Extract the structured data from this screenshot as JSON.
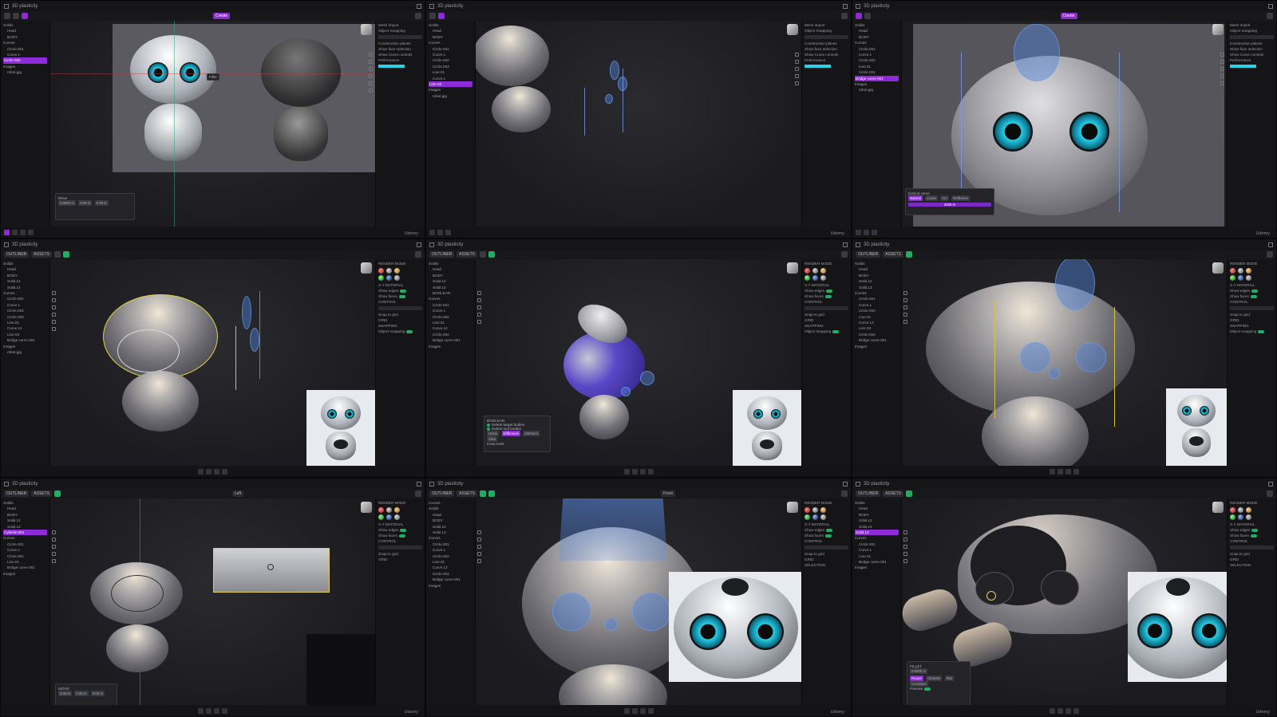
{
  "app": {
    "doc_title": "3D plasticity",
    "watermark": "Udemy",
    "colors": {
      "accent": "#8e2bd9",
      "toggle": "#1fae63",
      "selection_cyan": "#24d4e6",
      "viewport_bg": "#1e1e22"
    }
  },
  "cells": [
    {
      "id": "c1",
      "mode_label": "Create",
      "outliner": [
        "Solids",
        "Head",
        "BODY",
        "Curves",
        "Circle.001",
        "Curve.1",
        "Circle.002",
        "Images",
        "robot.jpg"
      ],
      "outliner_selected": "Circle.002",
      "props": [
        "Mesh Import",
        "Fillet",
        "Object Snapping",
        "Construction planes",
        "Show face selection",
        "Show Curve controls",
        "Performance"
      ],
      "popup": {
        "title": "Move",
        "fields": [
          "0.0000 m",
          "0.00 m",
          "0.00 m"
        ]
      },
      "tooltip": "Fillet"
    },
    {
      "id": "c2",
      "mode_label": "",
      "outliner": [
        "Solids",
        "Head",
        "BODY",
        "Curves",
        "Circle.001",
        "Curve.1",
        "Circle.002",
        "Circle.003",
        "Line.01",
        "Curve.1",
        "Line.03",
        "Images",
        "robot.jpg"
      ],
      "outliner_selected": "Line.03",
      "props": [
        "Mesh Import",
        "Object Snapping",
        "Construction planes",
        "Show face selection",
        "Show Curve controls",
        "Performance"
      ]
    },
    {
      "id": "c3",
      "mode_label": "Create",
      "outliner": [
        "Solids",
        "Head",
        "BODY",
        "Curves",
        "Circle.001",
        "Curve.1",
        "Circle.002",
        "Line.01",
        "Circle.004",
        "Bridge curve.001",
        "Images",
        "robot.jpg"
      ],
      "outliner_selected": "Bridge curve.001",
      "props": [
        "Mesh Import",
        "Object Snapping",
        "Construction planes",
        "Show face selection",
        "Show Curve controls",
        "Performance"
      ],
      "popup": {
        "title": "Extend curve",
        "chips": [
          "Natural",
          "Linear",
          "Arc",
          "Reflective",
          "Arc"
        ],
        "field": "2000 m"
      }
    },
    {
      "id": "c4",
      "tabs": [
        "OUTLINER",
        "ASSETS"
      ],
      "outliner": [
        "Solids",
        "Head",
        "BODY",
        "Solid.12",
        "Solid.13",
        "Curves",
        "Circle.001",
        "Curve.1",
        "Circle.002",
        "Circle.003",
        "Line.01",
        "Curve.12",
        "Line.03",
        "Bridge curve.001",
        "Images",
        "robot.jpg"
      ],
      "props": [
        "RENDER MODE",
        "X-Y MATERIAL",
        "Show edges",
        "Show faces",
        "CONTROL",
        "Snap to grid",
        "GRID",
        "SNAPPING",
        "Object snapping"
      ]
    },
    {
      "id": "c5",
      "tabs": [
        "OUTLINER",
        "ASSETS"
      ],
      "outliner": [
        "Solids",
        "Head",
        "BODY",
        "Solid.12",
        "Solid.13",
        "BOOLEAN",
        "Curves",
        "Circle.001",
        "Curve.1",
        "Circle.002",
        "Line.01",
        "Curve.12",
        "Circle.004",
        "Bridge curve.001",
        "Images"
      ],
      "props": [
        "RENDER MODE",
        "X-Y MATERIAL",
        "Show edges",
        "Show faces",
        "CONTROL",
        "Snap to grid",
        "GRID",
        "SNAPPING",
        "Object snapping"
      ],
      "popup": {
        "title": "BOOLEAN",
        "options": [
          "Delete target bodies",
          "Delete tool bodies"
        ],
        "chips": [
          "Union",
          "Difference",
          "Intersect",
          "Slice"
        ],
        "footer": "Keep tools"
      }
    },
    {
      "id": "c6",
      "tabs": [
        "OUTLINER",
        "ASSETS"
      ],
      "outliner": [
        "Solids",
        "Head",
        "BODY",
        "Solid.12",
        "Solid.13",
        "Curves",
        "Circle.001",
        "Curve.1",
        "Circle.002",
        "Line.01",
        "Curve.12",
        "Line.03",
        "Circle.004",
        "Bridge curve.001",
        "Images"
      ],
      "props": [
        "RENDER MODE",
        "X-Y MATERIAL",
        "Show edges",
        "Show faces",
        "CONTROL",
        "Snap to grid",
        "GRID",
        "SNAPPING",
        "Object snapping"
      ]
    },
    {
      "id": "c7",
      "tabs": [
        "OUTLINER",
        "ASSETS"
      ],
      "outliner": [
        "Solids",
        "Head",
        "BODY",
        "Solid.12",
        "Solid.13",
        "Cylinder.001",
        "Curves",
        "Circle.001",
        "Curve.1",
        "Circle.002",
        "Line.01",
        "Bridge curve.001",
        "Images"
      ],
      "outliner_selected": "Cylinder.001",
      "props": [
        "RENDER MODE",
        "X-Y MATERIAL",
        "Show edges",
        "Show faces",
        "CONTROL",
        "Snap to grid",
        "GRID"
      ],
      "popup": {
        "title": "MOVE",
        "fields": [
          "0.00 m",
          "0.00 m",
          "0.00 m"
        ]
      },
      "view_label": "Left"
    },
    {
      "id": "c8",
      "tabs": [
        "OUTLINER",
        "ASSETS"
      ],
      "outliner": [
        "Curves",
        "Solids",
        "Head",
        "BODY",
        "Solid.12",
        "Solid.13",
        "Curves",
        "Circle.001",
        "Curve.1",
        "Circle.002",
        "Line.01",
        "Curve.12",
        "Circle.004",
        "Bridge curve.001",
        "Images"
      ],
      "props": [
        "RENDER MODE",
        "X-Y MATERIAL",
        "Show edges",
        "Show faces",
        "CONTROL",
        "Snap to grid",
        "GRID",
        "SELECTION"
      ],
      "view_label": "Front"
    },
    {
      "id": "c9",
      "tabs": [
        "OUTLINER",
        "ASSETS"
      ],
      "outliner": [
        "Solids",
        "Head",
        "BODY",
        "Solid.12",
        "Solid.13",
        "Solid.14",
        "Curves",
        "Circle.001",
        "Curve.1",
        "Line.01",
        "Bridge curve.001",
        "Images"
      ],
      "outliner_selected": "Solid.14",
      "props": [
        "RENDER MODE",
        "X-Y MATERIAL",
        "Show edges",
        "Show faces",
        "CONTROL",
        "Snap to grid",
        "GRID",
        "SELECTION"
      ],
      "popup": {
        "title": "FILLET",
        "fields": [
          "0.0000 m"
        ],
        "chips": [
          "Round",
          "Chamfer",
          "Flat",
          "Curvature"
        ],
        "footer": "Preview"
      }
    }
  ]
}
